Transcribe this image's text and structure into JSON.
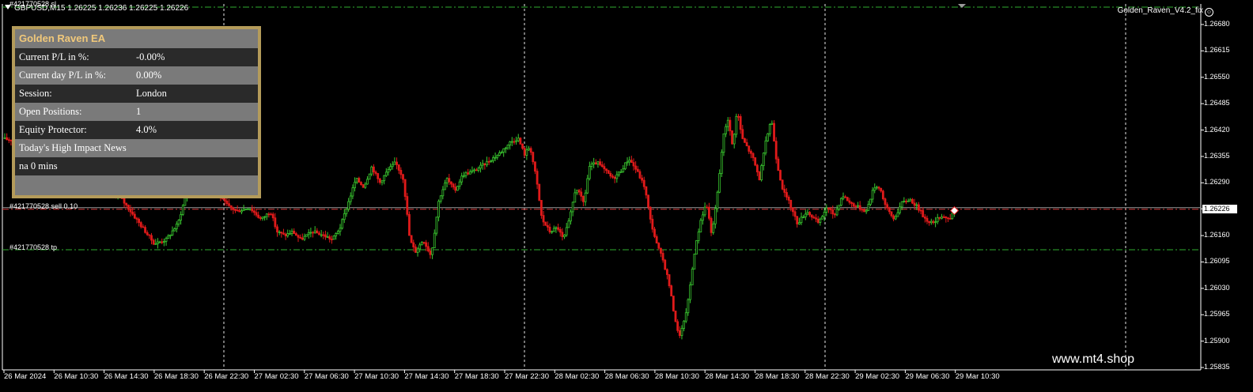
{
  "window": {
    "symbol_header": "GBPUSD,M15  1.26225 1.26236 1.26225 1.26226",
    "indicator_name": "Golden_Raven_V4.2_fix",
    "watermark": "www.mt4.shop"
  },
  "panel": {
    "title": "Golden Raven EA",
    "rows": [
      {
        "label": "Current P/L in %:",
        "value": "-0.00%"
      },
      {
        "label": "Current day P/L in %:",
        "value": "0.00%"
      },
      {
        "label": "Session:",
        "value": "London"
      },
      {
        "label": "Open Positions:",
        "value": "1"
      },
      {
        "label": "Equity Protector:",
        "value": "4.0%"
      },
      {
        "label": "Today's High Impact News",
        "value": ""
      },
      {
        "label": "na 0 mins",
        "value": ""
      },
      {
        "label": "",
        "value": ""
      }
    ]
  },
  "orders": {
    "entry_label": "#421770528 sell 0.10",
    "tp_label": "#421770528 tp",
    "sl_label": "#421770528 sl"
  },
  "colors": {
    "bull": "#39c72f",
    "bear": "#e01a1a",
    "entry_line": "#d53a3a",
    "tp_line": "#2fae2f",
    "panel_border": "#b49b5a",
    "panel_title": "#f0c87a"
  },
  "chart_data": {
    "type": "candlestick",
    "symbol": "GBPUSD",
    "timeframe": "M15",
    "current_price": "1.26226",
    "price_ticks": [
      "1.26680",
      "1.26615",
      "1.26550",
      "1.26485",
      "1.26420",
      "1.26355",
      "1.26290",
      "1.26226",
      "1.26160",
      "1.26095",
      "1.26030",
      "1.25965",
      "1.25900",
      "1.25835"
    ],
    "time_ticks": [
      "26 Mar 2024",
      "26 Mar 10:30",
      "26 Mar 14:30",
      "26 Mar 18:30",
      "26 Mar 22:30",
      "27 Mar 02:30",
      "27 Mar 06:30",
      "27 Mar 10:30",
      "27 Mar 14:30",
      "27 Mar 18:30",
      "27 Mar 22:30",
      "28 Mar 02:30",
      "28 Mar 06:30",
      "28 Mar 10:30",
      "28 Mar 14:30",
      "28 Mar 18:30",
      "28 Mar 22:30",
      "29 Mar 02:30",
      "29 Mar 06:30",
      "29 Mar 10:30"
    ],
    "ylim": [
      1.2583,
      1.2671
    ],
    "entry_price": 1.26225,
    "tp_price": 1.26125,
    "sl_price": 1.26725,
    "price_path": [
      [
        0,
        1.264
      ],
      [
        30,
        1.2639
      ],
      [
        45,
        1.2634
      ],
      [
        80,
        1.2632
      ],
      [
        100,
        1.263
      ],
      [
        120,
        1.2627
      ],
      [
        150,
        1.2626
      ],
      [
        165,
        1.2622
      ],
      [
        180,
        1.2618
      ],
      [
        195,
        1.2614
      ],
      [
        210,
        1.2615
      ],
      [
        225,
        1.2619
      ],
      [
        235,
        1.2626
      ],
      [
        245,
        1.2632
      ],
      [
        255,
        1.263
      ],
      [
        262,
        1.2635
      ],
      [
        270,
        1.2629
      ],
      [
        280,
        1.2625
      ],
      [
        290,
        1.2623
      ],
      [
        300,
        1.2622
      ],
      [
        315,
        1.2623
      ],
      [
        330,
        1.262
      ],
      [
        342,
        1.2622
      ],
      [
        350,
        1.2617
      ],
      [
        360,
        1.2616
      ],
      [
        370,
        1.2617
      ],
      [
        380,
        1.2615
      ],
      [
        395,
        1.2617
      ],
      [
        410,
        1.2616
      ],
      [
        420,
        1.2615
      ],
      [
        430,
        1.2618
      ],
      [
        440,
        1.2624
      ],
      [
        450,
        1.263
      ],
      [
        460,
        1.2628
      ],
      [
        470,
        1.2633
      ],
      [
        480,
        1.2629
      ],
      [
        490,
        1.2632
      ],
      [
        500,
        1.2634
      ],
      [
        510,
        1.263
      ],
      [
        518,
        1.2615
      ],
      [
        525,
        1.2612
      ],
      [
        535,
        1.2615
      ],
      [
        545,
        1.2611
      ],
      [
        555,
        1.2625
      ],
      [
        565,
        1.263
      ],
      [
        575,
        1.2627
      ],
      [
        585,
        1.2631
      ],
      [
        600,
        1.2632
      ],
      [
        615,
        1.2634
      ],
      [
        630,
        1.2636
      ],
      [
        645,
        1.2639
      ],
      [
        655,
        1.264
      ],
      [
        663,
        1.2636
      ],
      [
        670,
        1.2638
      ],
      [
        678,
        1.263
      ],
      [
        685,
        1.262
      ],
      [
        695,
        1.2617
      ],
      [
        705,
        1.2618
      ],
      [
        712,
        1.2615
      ],
      [
        720,
        1.262
      ],
      [
        728,
        1.2628
      ],
      [
        738,
        1.2624
      ],
      [
        745,
        1.2633
      ],
      [
        755,
        1.2634
      ],
      [
        765,
        1.2632
      ],
      [
        775,
        1.263
      ],
      [
        785,
        1.2632
      ],
      [
        795,
        1.2635
      ],
      [
        805,
        1.2632
      ],
      [
        815,
        1.2628
      ],
      [
        822,
        1.262
      ],
      [
        830,
        1.2614
      ],
      [
        838,
        1.261
      ],
      [
        845,
        1.2605
      ],
      [
        852,
        1.2597
      ],
      [
        858,
        1.2591
      ],
      [
        864,
        1.2594
      ],
      [
        870,
        1.26
      ],
      [
        878,
        1.2612
      ],
      [
        886,
        1.262
      ],
      [
        893,
        1.2624
      ],
      [
        900,
        1.2616
      ],
      [
        908,
        1.2628
      ],
      [
        914,
        1.264
      ],
      [
        920,
        1.2645
      ],
      [
        926,
        1.2638
      ],
      [
        932,
        1.2647
      ],
      [
        938,
        1.264
      ],
      [
        944,
        1.2638
      ],
      [
        952,
        1.2635
      ],
      [
        960,
        1.263
      ],
      [
        968,
        1.2639
      ],
      [
        975,
        1.2645
      ],
      [
        982,
        1.2634
      ],
      [
        990,
        1.2627
      ],
      [
        998,
        1.2624
      ],
      [
        1008,
        1.2619
      ],
      [
        1020,
        1.2622
      ],
      [
        1035,
        1.2619
      ],
      [
        1045,
        1.2623
      ],
      [
        1055,
        1.2621
      ],
      [
        1065,
        1.2626
      ],
      [
        1075,
        1.2624
      ],
      [
        1085,
        1.2623
      ],
      [
        1095,
        1.2622
      ],
      [
        1105,
        1.2628
      ],
      [
        1112,
        1.2628
      ],
      [
        1120,
        1.2623
      ],
      [
        1130,
        1.262
      ],
      [
        1140,
        1.2624
      ],
      [
        1150,
        1.2625
      ],
      [
        1160,
        1.2623
      ],
      [
        1170,
        1.262
      ],
      [
        1180,
        1.2619
      ],
      [
        1190,
        1.2621
      ],
      [
        1200,
        1.262
      ],
      [
        1207,
        1.2622
      ]
    ]
  }
}
